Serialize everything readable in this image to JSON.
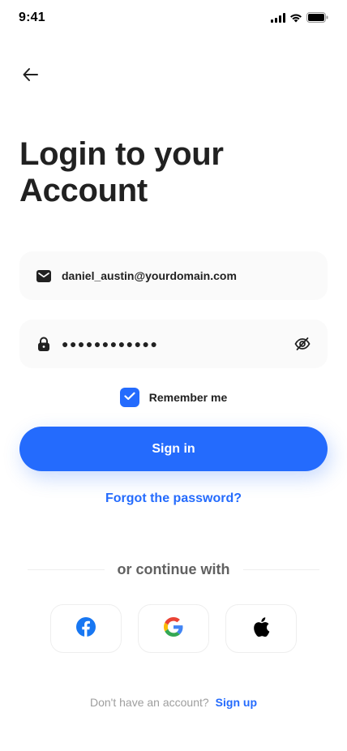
{
  "status_bar": {
    "time": "9:41",
    "icons": [
      "cellular-signal-icon",
      "wifi-icon",
      "battery-icon"
    ]
  },
  "header": {
    "back_icon": "arrow-left-icon"
  },
  "title": {
    "line1": "Login to your",
    "line2": "Account"
  },
  "form": {
    "email": {
      "icon": "envelope-icon",
      "value": "daniel_austin@yourdomain.com"
    },
    "password": {
      "icon": "lock-icon",
      "masked_value": "●●●●●●●●●●●●",
      "toggle_icon": "eye-slash-icon"
    },
    "remember": {
      "label": "Remember me",
      "checked": true
    },
    "submit_label": "Sign in",
    "forgot_label": "Forgot the password?"
  },
  "divider": {
    "label": "or continue with"
  },
  "social": [
    {
      "name": "facebook",
      "icon": "facebook-icon"
    },
    {
      "name": "google",
      "icon": "google-icon"
    },
    {
      "name": "apple",
      "icon": "apple-icon"
    }
  ],
  "footer": {
    "prompt": "Don't have an account?",
    "signup_label": "Sign up"
  },
  "colors": {
    "primary": "#246BFD",
    "text": "#212121",
    "field_bg": "#FAFAFA",
    "muted": "#9E9E9E"
  }
}
